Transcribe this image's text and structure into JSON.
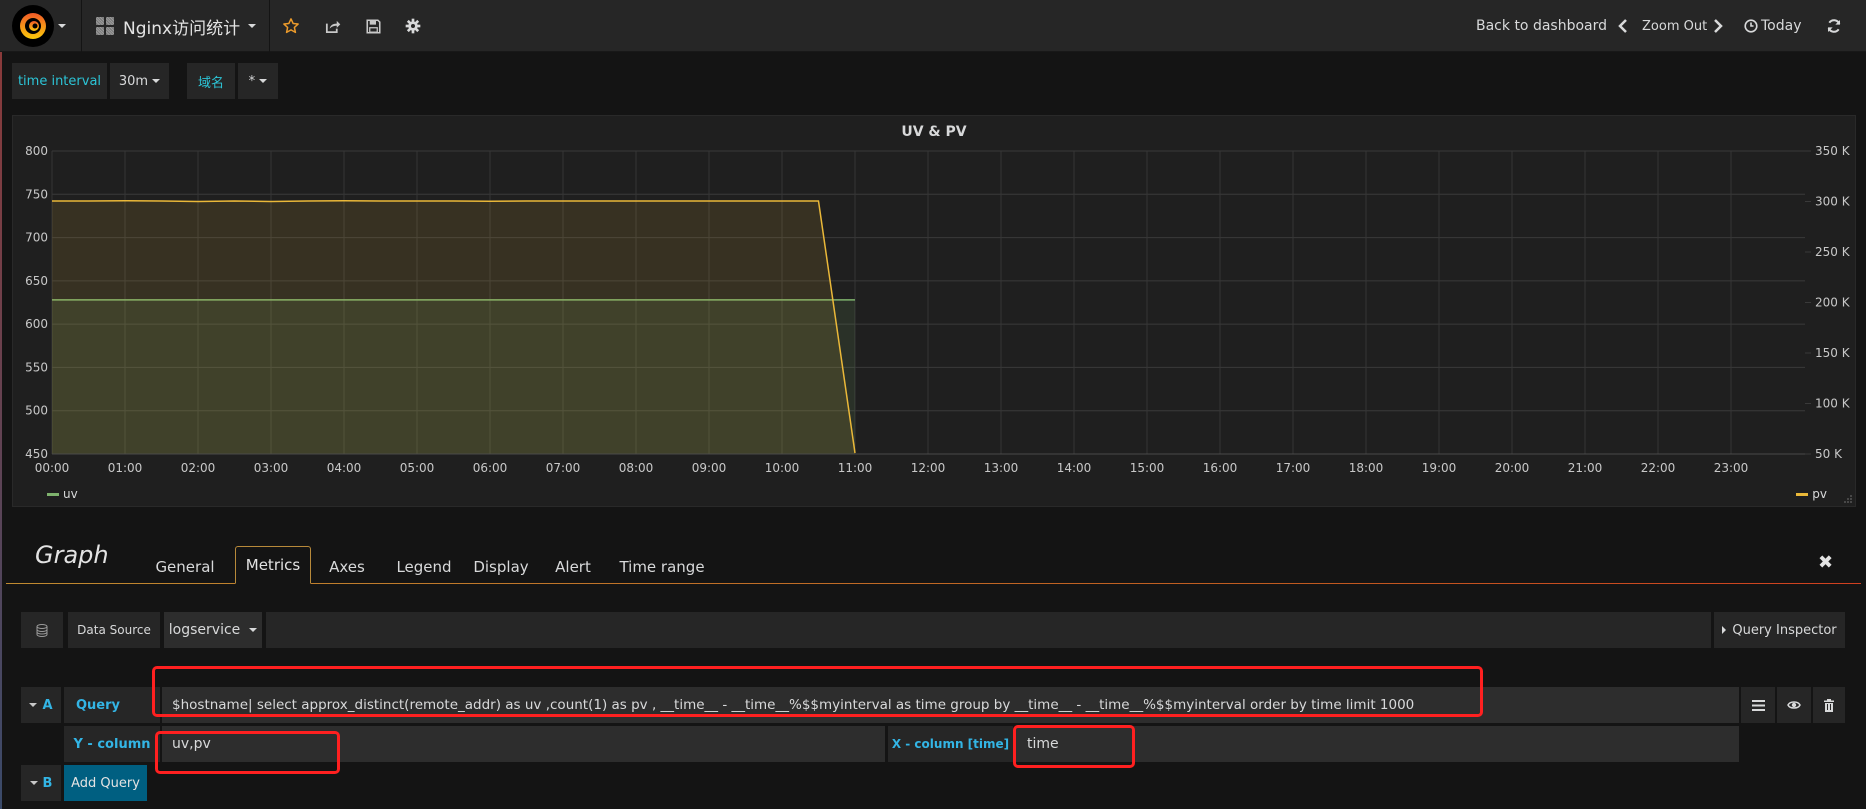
{
  "navbar": {
    "dashboard_title": "Nginx访问统计",
    "back_to_dashboard": "Back to dashboard",
    "zoom_out": "Zoom Out",
    "time_range": "Today",
    "icons": [
      "grafana-logo-icon",
      "star-icon",
      "share-icon",
      "save-icon",
      "gear-icon",
      "chevron-left-icon",
      "chevron-right-icon",
      "clock-icon",
      "refresh-icon"
    ]
  },
  "variables": [
    {
      "label": "time interval",
      "value": "30m"
    },
    {
      "label": "域名",
      "value": "*"
    }
  ],
  "panel": {
    "title": "UV & PV"
  },
  "chart_data": {
    "type": "line",
    "title": "UV & PV",
    "x": [
      "00:00",
      "00:30",
      "01:00",
      "01:30",
      "02:00",
      "02:30",
      "03:00",
      "03:30",
      "04:00",
      "04:30",
      "05:00",
      "05:30",
      "06:00",
      "06:30",
      "07:00",
      "07:30",
      "08:00",
      "08:30",
      "09:00",
      "09:30",
      "10:00",
      "10:30",
      "11:00"
    ],
    "x_ticks": [
      "00:00",
      "01:00",
      "02:00",
      "03:00",
      "04:00",
      "05:00",
      "06:00",
      "07:00",
      "08:00",
      "09:00",
      "10:00",
      "11:00",
      "12:00",
      "13:00",
      "14:00",
      "15:00",
      "16:00",
      "17:00",
      "18:00",
      "19:00",
      "20:00",
      "21:00",
      "22:00",
      "23:00"
    ],
    "x_range_hours": [
      0,
      24
    ],
    "y_left": {
      "ticks": [
        "450",
        "500",
        "550",
        "600",
        "650",
        "700",
        "750",
        "800"
      ],
      "range": [
        450,
        800
      ]
    },
    "y_right": {
      "ticks": [
        "50 K",
        "100 K",
        "150 K",
        "200 K",
        "250 K",
        "300 K",
        "350 K"
      ],
      "range": [
        50000,
        350000
      ]
    },
    "grid": true,
    "series": [
      {
        "name": "uv",
        "axis": "left",
        "color": "#7eb26d",
        "values": [
          628,
          628,
          628,
          628,
          628,
          628,
          628,
          628,
          628,
          628,
          628,
          628,
          628,
          628,
          628,
          628,
          628,
          628,
          628,
          628,
          628,
          628,
          628
        ]
      },
      {
        "name": "pv",
        "axis": "right",
        "color": "#eab839",
        "values": [
          300500,
          300500,
          300800,
          300500,
          300000,
          300500,
          300000,
          300500,
          300700,
          300500,
          300500,
          300500,
          300300,
          300500,
          300500,
          300500,
          300500,
          300500,
          300500,
          300500,
          300500,
          300500,
          51000
        ]
      }
    ],
    "legend": {
      "left": "uv",
      "right": "pv",
      "placement": "bottom"
    }
  },
  "editor": {
    "title": "Graph",
    "tabs": [
      "General",
      "Metrics",
      "Axes",
      "Legend",
      "Display",
      "Alert",
      "Time range"
    ],
    "active_tab": "Metrics",
    "data_source_label": "Data Source",
    "data_source_value": "logservice",
    "query_inspector": "Query Inspector",
    "query_a": {
      "ref": "A",
      "query_label": "Query",
      "query_value": "$hostname| select approx_distinct(remote_addr) as uv ,count(1) as pv , __time__ - __time__%$$myinterval  as time group by __time__ - __time__%$$myinterval  order by time limit 1000",
      "y_column_label": "Y - column",
      "y_column_value": "uv,pv",
      "x_column_label": "X - column [time]",
      "x_column_value": "time"
    },
    "query_b": {
      "ref": "B",
      "add_query_label": "Add Query"
    }
  }
}
